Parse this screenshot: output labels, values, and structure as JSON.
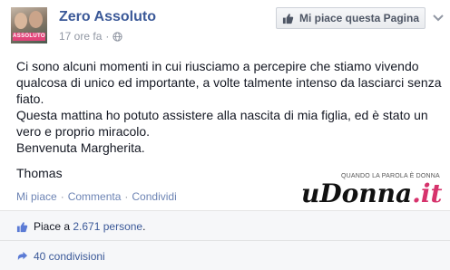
{
  "header": {
    "page_name": "Zero Assoluto",
    "timestamp": "17 ore fa",
    "separator": "·",
    "like_page_label": "Mi piace questa Pagina",
    "avatar_tag": "ASSOLUTO"
  },
  "post": {
    "paragraph_1": "Ci sono alcuni momenti in cui riusciamo a percepire che stiamo vivendo qualcosa di unico ed importante, a volte talmente intenso da lasciarci senza fiato.",
    "paragraph_2": "Questa mattina ho potuto assistere alla nascita di mia figlia, ed è stato un vero e proprio miracolo.",
    "paragraph_3": "Benvenuta Margherita.",
    "signature": "Thomas"
  },
  "actions": {
    "like": "Mi piace",
    "comment": "Commenta",
    "share": "Condividi",
    "separator": "·"
  },
  "watermark": {
    "tagline": "QUANDO LA PAROLA È DONNA",
    "logo_main": "uDonna",
    "logo_suffix": ".it"
  },
  "footer": {
    "likes_prefix": "Piace a",
    "likes_count": "2.671 persone",
    "likes_suffix": ".",
    "shares": "40 condivisioni"
  },
  "colors": {
    "link_blue": "#3b5998",
    "muted_gray": "#9197a3",
    "footer_bg": "#f6f7f9"
  },
  "icons": [
    "globe-icon",
    "thumbs-up-icon",
    "chevron-down-icon",
    "share-icon"
  ]
}
